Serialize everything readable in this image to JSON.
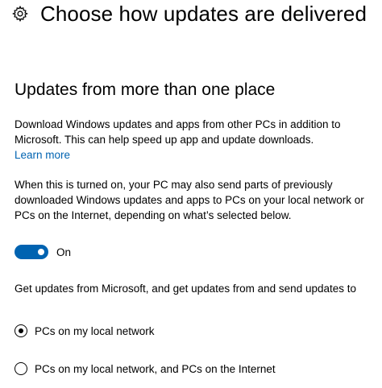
{
  "header": {
    "icon": "gear-icon",
    "title": "Choose how updates are delivered"
  },
  "section": {
    "title": "Updates from more than one place",
    "description": "Download Windows updates and apps from other PCs in addition to Microsoft. This can help speed up app and update downloads.",
    "learn_more": "Learn more",
    "info": "When this is turned on, your PC may also send parts of previously downloaded Windows updates and apps to PCs on your local network or PCs on the Internet, depending on what’s selected below."
  },
  "toggle": {
    "state": "On",
    "is_on": true
  },
  "get_updates_text": "Get updates from Microsoft, and get updates from and send updates to",
  "radio_options": [
    {
      "label": "PCs on my local network",
      "selected": true
    },
    {
      "label": "PCs on my local network, and PCs on the Internet",
      "selected": false
    }
  ],
  "colors": {
    "accent": "#0063b1",
    "text": "#000000",
    "background": "#ffffff"
  }
}
